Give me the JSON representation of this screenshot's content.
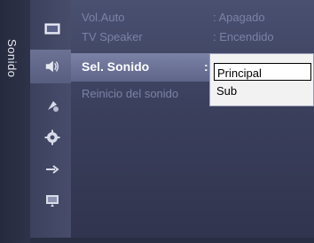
{
  "side_label": "Sonido",
  "icons": [
    {
      "name": "picture-icon"
    },
    {
      "name": "sound-icon",
      "active": true
    },
    {
      "name": "channel-icon"
    },
    {
      "name": "settings-gear-icon"
    },
    {
      "name": "input-icon"
    },
    {
      "name": "application-icon"
    }
  ],
  "menu": {
    "items": [
      {
        "label": "Vol.Auto",
        "value": ": Apagado"
      },
      {
        "label": "TV Speaker",
        "value": ": Encendido"
      },
      {
        "label": "Sel. Sonido",
        "value": ":"
      },
      {
        "label": "Reinicio del sonido",
        "value": ""
      }
    ]
  },
  "dropdown": {
    "options": [
      "Principal",
      "Sub"
    ],
    "selected": "Principal"
  },
  "colors": {
    "background": "#3a3f5c",
    "selected_row": "#6b7294",
    "inactive_text": "#7c82a6",
    "dropdown_bg": "#f2f2f2"
  }
}
